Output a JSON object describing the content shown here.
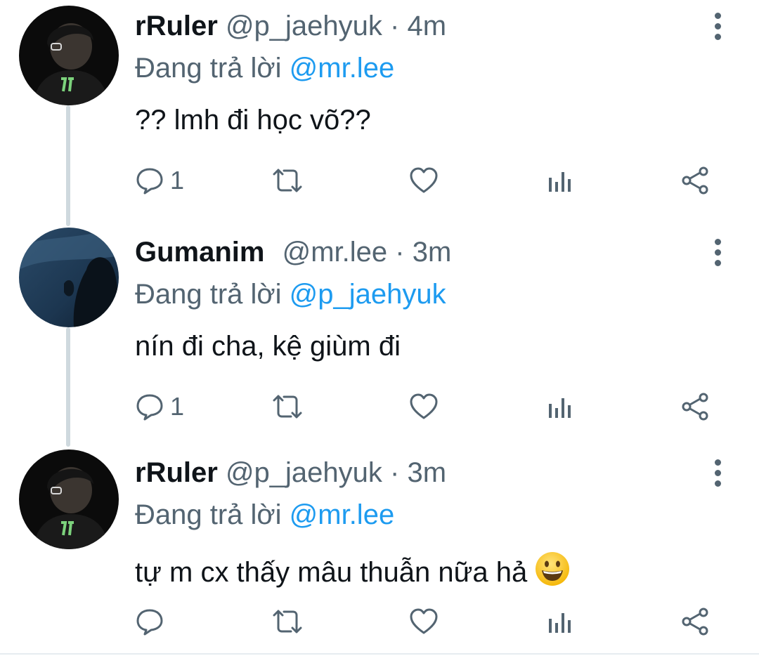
{
  "tweets": [
    {
      "name": "rRuler",
      "handle": "@p_jaehyuk",
      "time": "4m",
      "reply_prefix": "Đang trả lời ",
      "reply_to": "@mr.lee",
      "text": "?? lmh đi học võ??",
      "emoji": "",
      "reply_count": "1",
      "avatar": "user-photo-dark"
    },
    {
      "name": "Gumanim",
      "handle": "@mr.lee",
      "time": "3m",
      "reply_prefix": "Đang trả lời ",
      "reply_to": "@p_jaehyuk",
      "text": "nín đi cha, kệ giùm đi",
      "emoji": "",
      "reply_count": "1",
      "avatar": "user-photo-blue"
    },
    {
      "name": "rRuler",
      "handle": "@p_jaehyuk",
      "time": "3m",
      "reply_prefix": "Đang trả lời ",
      "reply_to": "@mr.lee",
      "text": "tự m cx thấy mâu thuẫn nữa hả",
      "emoji": "grinning-face",
      "reply_count": "",
      "avatar": "user-photo-dark"
    }
  ],
  "separator": "·",
  "colors": {
    "text": "#0f1419",
    "secondary": "#536471",
    "mention": "#1d9bf0",
    "thread_line": "#cfd9de"
  }
}
